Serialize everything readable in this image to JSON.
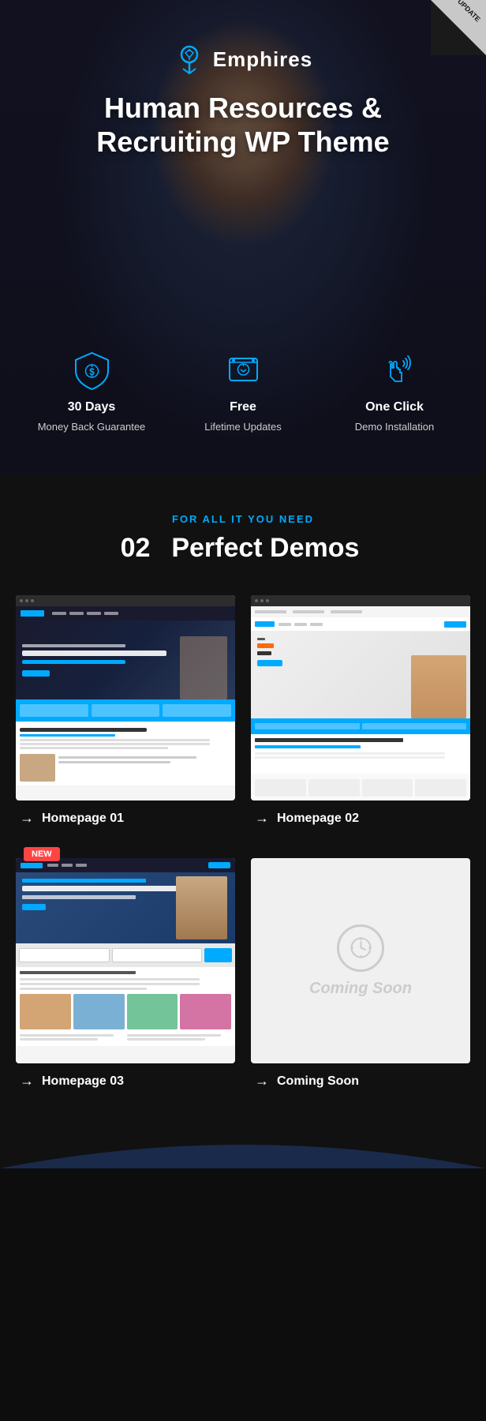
{
  "update_badge": "UPDATE",
  "logo": {
    "text": "Emphires"
  },
  "hero": {
    "title_line1": "Human Resources &",
    "title_line2": "Recruiting WP Theme"
  },
  "features": [
    {
      "title": "30 Days",
      "subtitle": "Money Back Guarantee",
      "icon": "shield-icon"
    },
    {
      "title": "Free",
      "subtitle": "Lifetime Updates",
      "icon": "update-icon"
    },
    {
      "title": "One Click",
      "subtitle": "Demo Installation",
      "icon": "click-icon"
    }
  ],
  "demos_section": {
    "tag": "FOR ALL IT YOU NEED",
    "title_number": "02",
    "title_text": "Perfect Demos"
  },
  "demos": [
    {
      "id": "hp1",
      "label": "Homepage 01",
      "is_new": false,
      "coming_soon": false
    },
    {
      "id": "hp2",
      "label": "Homepage 02",
      "is_new": false,
      "coming_soon": false
    },
    {
      "id": "hp3",
      "label": "Homepage 03",
      "is_new": true,
      "coming_soon": false
    },
    {
      "id": "cs",
      "label": "Coming Soon",
      "is_new": false,
      "coming_soon": true
    }
  ],
  "new_badge_label": "NEW",
  "coming_soon_text": "Coming Soon",
  "arrow_symbol": "→"
}
